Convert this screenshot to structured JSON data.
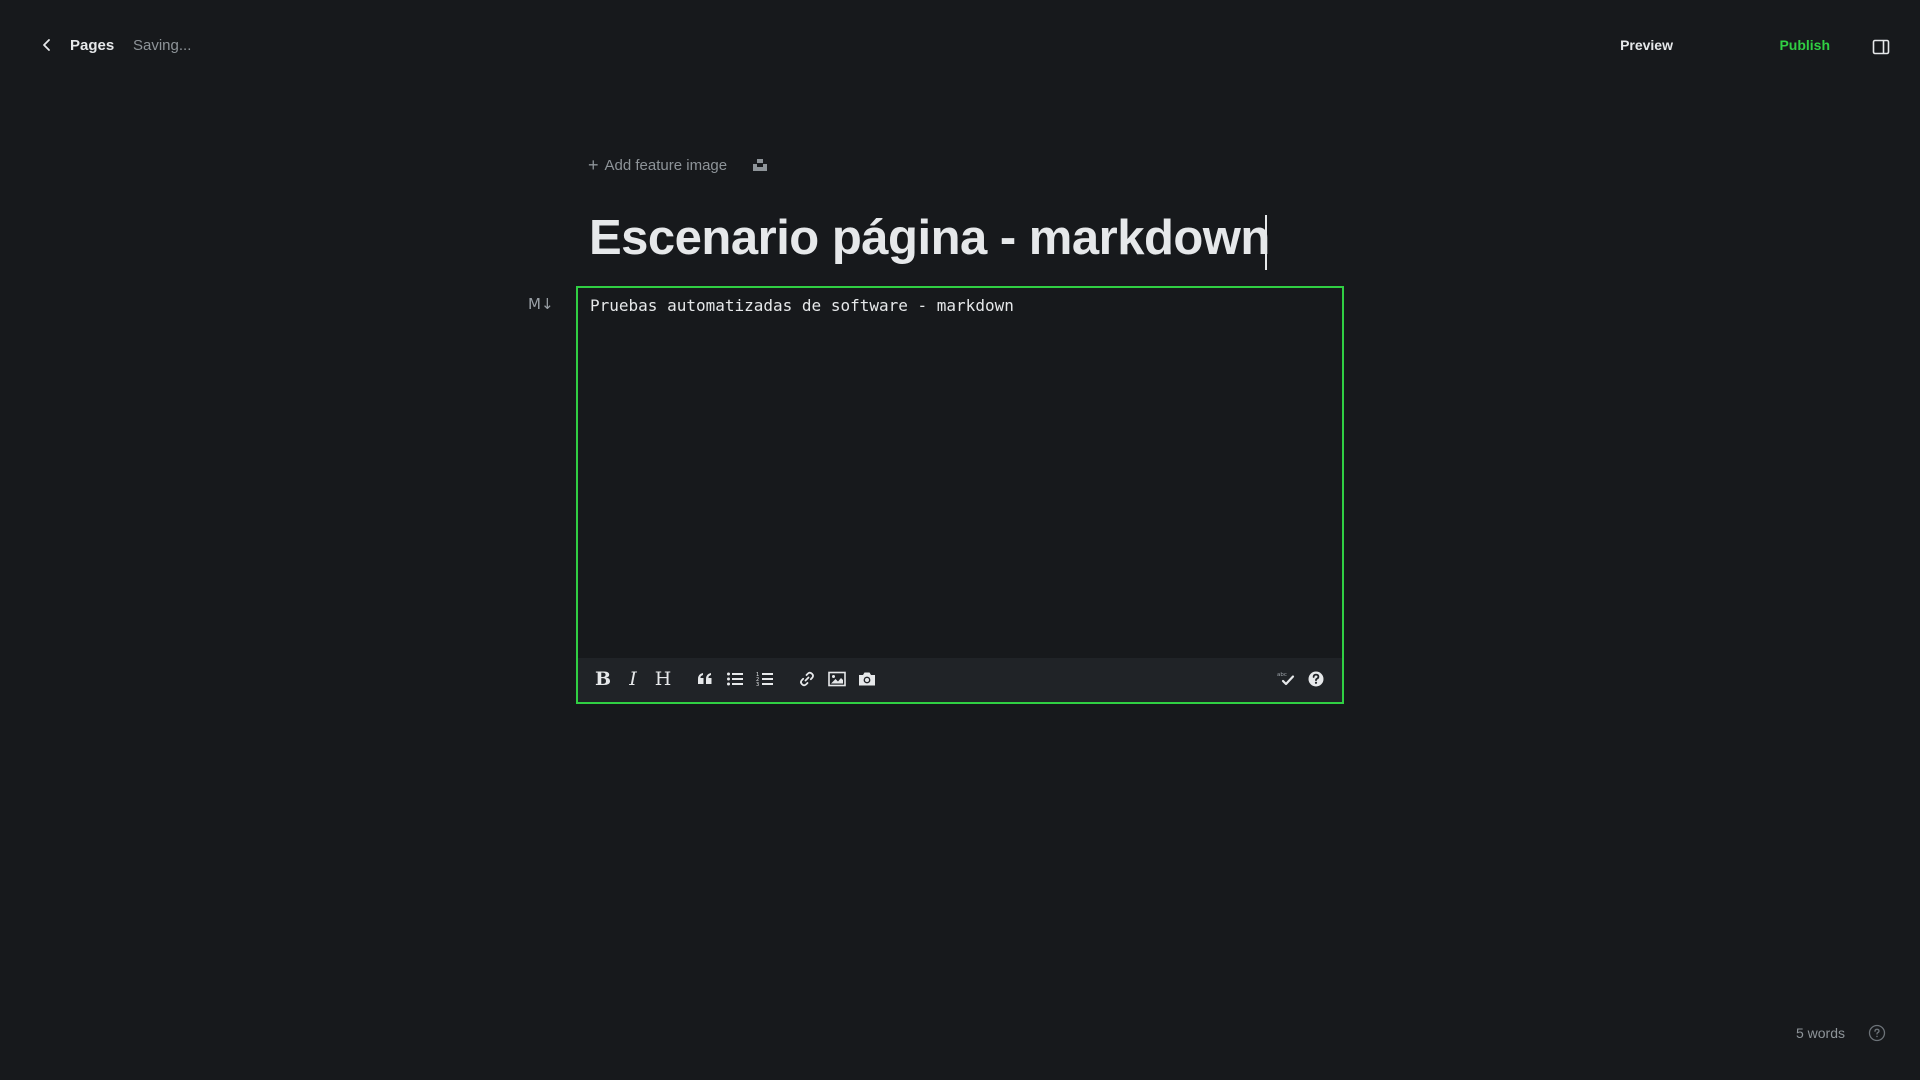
{
  "header": {
    "back_label": "Pages",
    "status": "Saving...",
    "preview_label": "Preview",
    "publish_label": "Publish"
  },
  "post": {
    "feature_image_label": "Add feature image",
    "title": "Escenario página - markdown",
    "markdown_badge": "M↓",
    "body": "Pruebas automatizadas de software - markdown"
  },
  "toolbar": {
    "bold": "B",
    "italic": "I",
    "heading": "H",
    "icons": [
      "bold-icon",
      "italic-icon",
      "heading-icon",
      "quote-icon",
      "unordered-list-icon",
      "ordered-list-icon",
      "link-icon",
      "image-icon",
      "camera-icon",
      "spellcheck-icon",
      "help-icon"
    ]
  },
  "footer": {
    "word_count": "5 words"
  },
  "colors": {
    "background": "#17191c",
    "accent": "#30cf43",
    "text": "#e6e8ea",
    "muted": "#8e9499"
  }
}
